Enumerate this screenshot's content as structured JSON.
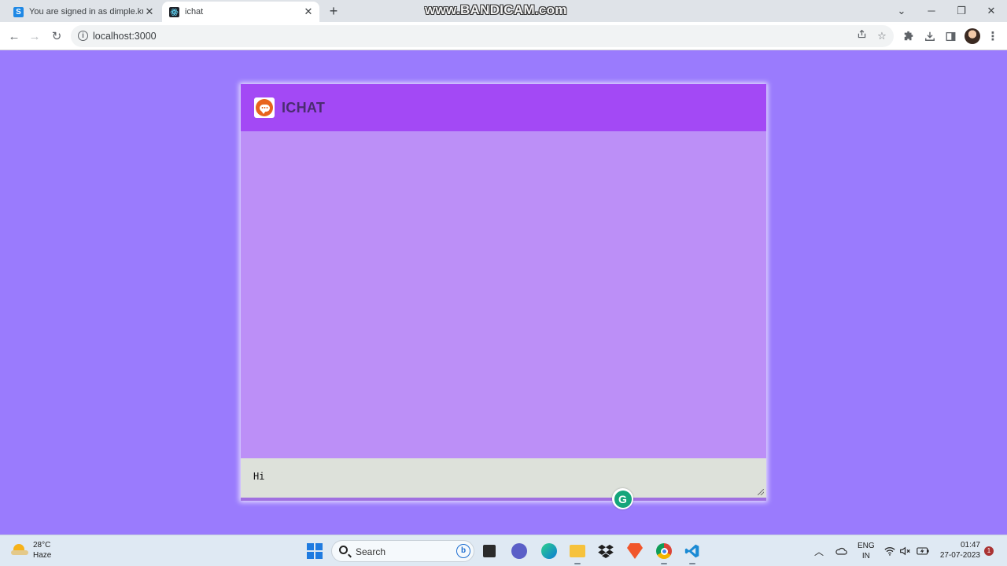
{
  "browser": {
    "tabs": [
      {
        "title": "You are signed in as dimple.kuma",
        "close": "✕"
      },
      {
        "title": "ichat",
        "close": "✕"
      }
    ],
    "new_tab": "+",
    "watermark": "www.BANDICAM.com",
    "window_controls": {
      "tab_search": "⌄",
      "minimize": "─",
      "maximize": "❐",
      "close": "✕"
    },
    "nav": {
      "back": "←",
      "forward": "→",
      "reload": "↻"
    },
    "address": {
      "info": "i",
      "url": "localhost:3000"
    },
    "toolbar_icons": [
      "share-icon",
      "star-icon",
      "extensions-icon",
      "download-icon",
      "sidepanel-icon",
      "profile-avatar",
      "menu-icon"
    ]
  },
  "app": {
    "title": "ICHAT",
    "input_value": "Hi",
    "colors": {
      "page_bg": "#9a7bfd",
      "header_bg": "#a349f5",
      "chat_bg": "#bc8ff7",
      "input_bg": "#dde1da",
      "logo": "#e8631d"
    }
  },
  "grammarly": {
    "letter": "G"
  },
  "taskbar": {
    "weather": {
      "temp": "28°C",
      "condition": "Haze"
    },
    "search_label": "Search",
    "bing_letter": "b",
    "tray": {
      "lang_line1": "ENG",
      "lang_line2": "IN"
    },
    "clock": {
      "time": "01:47",
      "date": "27-07-2023"
    },
    "notification_count": "1"
  }
}
